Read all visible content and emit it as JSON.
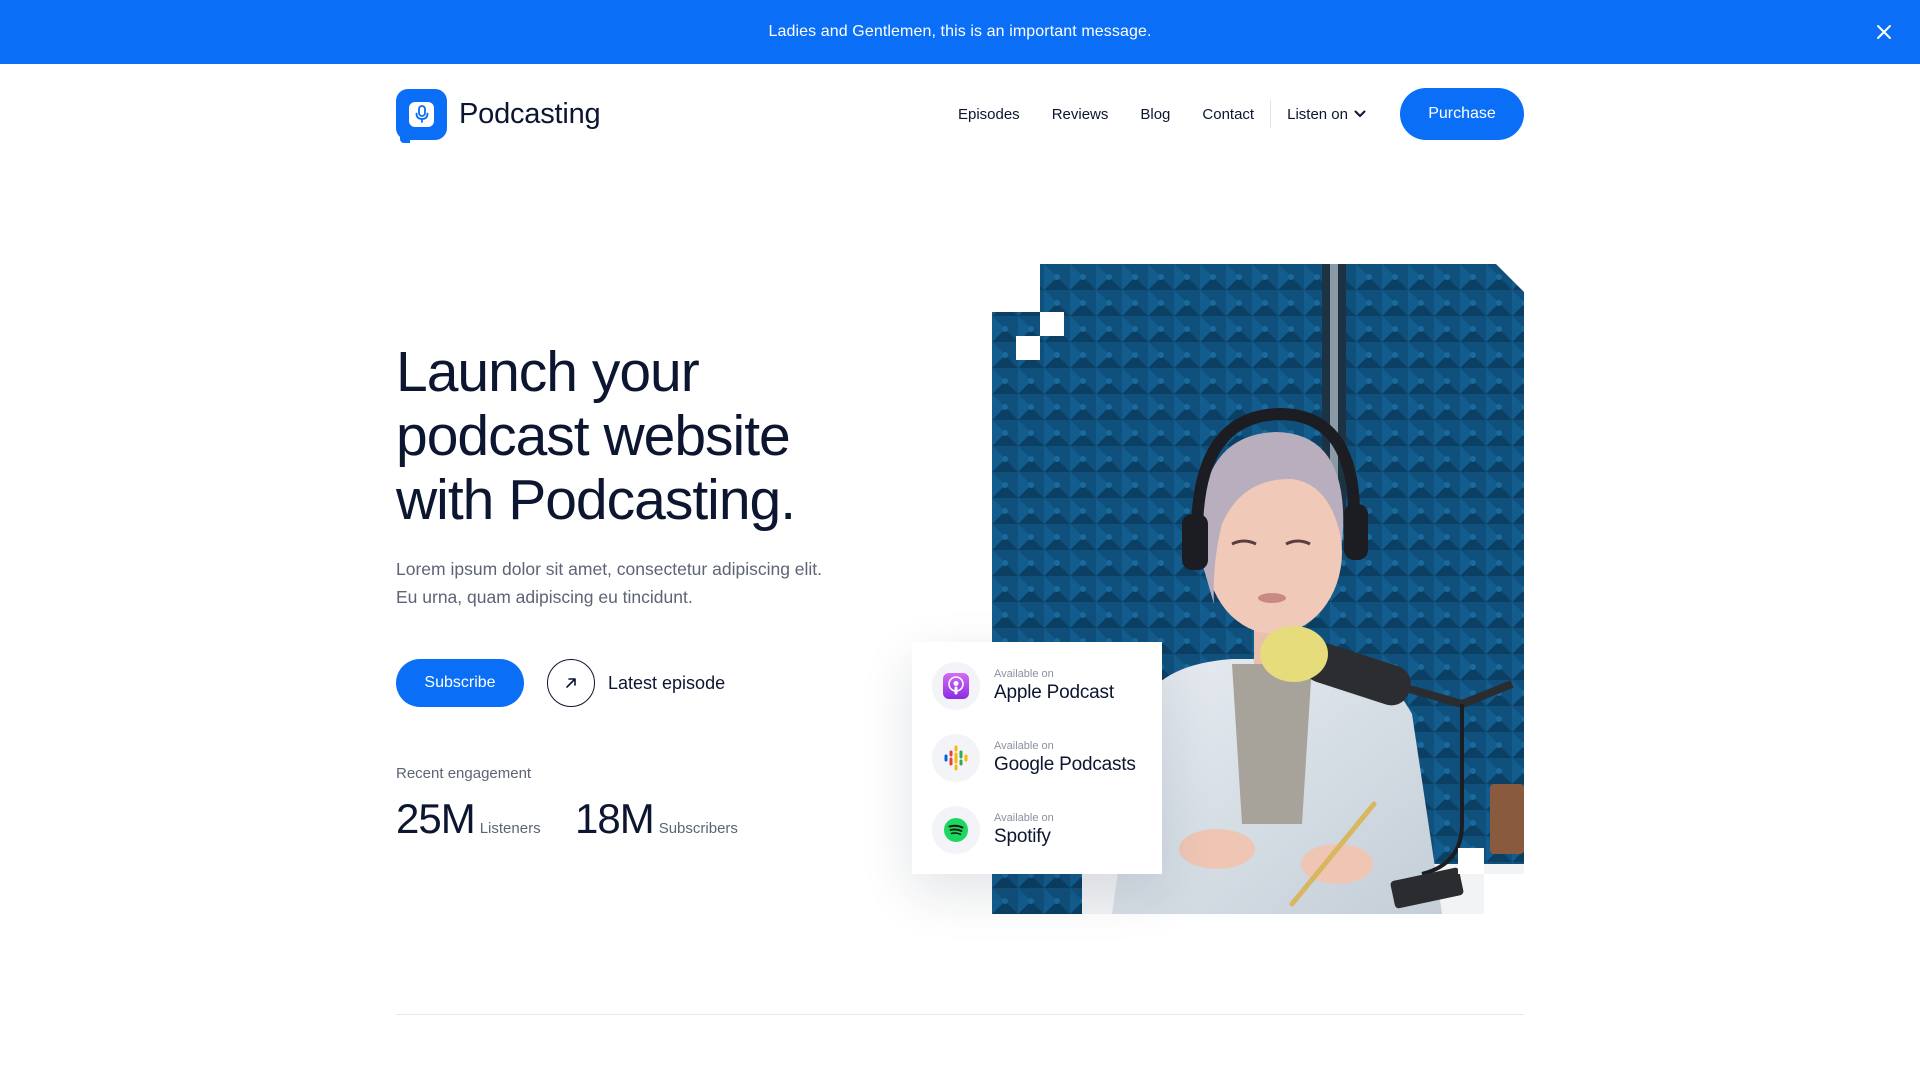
{
  "colors": {
    "accent": "#0a6ef7",
    "text": "#0d1630",
    "muted": "#5c6475"
  },
  "announcement": {
    "text": "Ladies and Gentlemen, this is an important message.",
    "close_icon": "close-icon"
  },
  "header": {
    "logo_text": "Podcasting",
    "logo_icon": "microphone-icon",
    "nav": [
      "Episodes",
      "Reviews",
      "Blog",
      "Contact"
    ],
    "listen_label": "Listen on",
    "purchase_label": "Purchase"
  },
  "hero": {
    "title_lines": [
      "Launch your",
      "podcast website",
      "with Podcasting."
    ],
    "description_lines": [
      "Lorem ipsum dolor sit amet, consectetur adipiscing elit.",
      "Eu urna, quam adipiscing eu tincidunt."
    ],
    "subscribe_label": "Subscribe",
    "latest_label": "Latest episode"
  },
  "engagement": {
    "label": "Recent engagement",
    "stats": [
      {
        "value": "25M",
        "unit": "Listeners"
      },
      {
        "value": "18M",
        "unit": "Subscribers"
      }
    ]
  },
  "platforms": [
    {
      "available": "Available on",
      "name": "Apple Podcast",
      "icon": "apple-podcasts-icon"
    },
    {
      "available": "Available on",
      "name": "Google Podcasts",
      "icon": "google-podcasts-icon"
    },
    {
      "available": "Available on",
      "name": "Spotify",
      "icon": "spotify-icon"
    }
  ]
}
